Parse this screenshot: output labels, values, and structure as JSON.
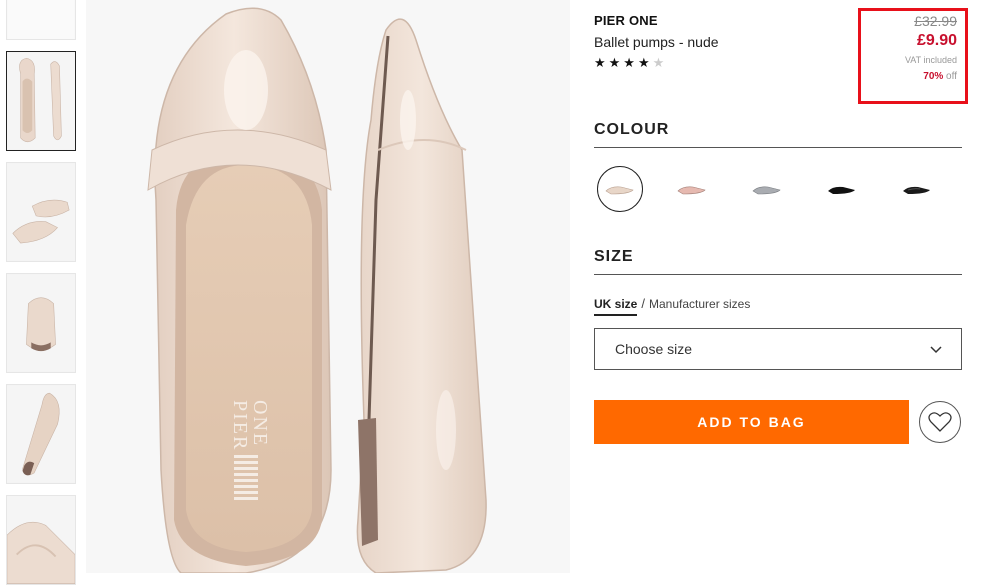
{
  "product": {
    "brand": "PIER ONE",
    "name": "Ballet pumps - nude",
    "rating": 4,
    "rating_max": 5,
    "stars_filled": "★★★★",
    "stars_empty": "★",
    "old_price": "£32.99",
    "price": "£9.90",
    "vat": "VAT included",
    "discount": "70%",
    "discount_suffix": " off",
    "insole_brand_top": "PIER",
    "insole_brand_bottom": "ONE"
  },
  "colour": {
    "title": "COLOUR",
    "swatches": [
      {
        "name": "nude",
        "color": "#e8d6c8",
        "selected": true
      },
      {
        "name": "pink",
        "color": "#e6b9b0",
        "selected": false
      },
      {
        "name": "grey",
        "color": "#a9acb1",
        "selected": false
      },
      {
        "name": "black",
        "color": "#111111",
        "selected": false
      },
      {
        "name": "black-patent",
        "color": "#1a1a1a",
        "selected": false
      }
    ]
  },
  "size": {
    "title": "SIZE",
    "tab_uk": "UK size",
    "tab_separator": "/",
    "tab_manufacturer": "Manufacturer sizes",
    "select_placeholder": "Choose size"
  },
  "actions": {
    "add_to_bag": "ADD TO BAG"
  },
  "colors": {
    "accent_orange": "#ff6900",
    "price_red": "#c8102e",
    "highlight_border": "#e8101a"
  }
}
